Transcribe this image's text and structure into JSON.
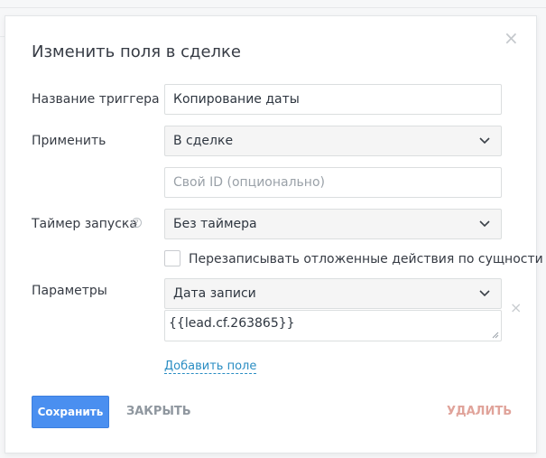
{
  "dialog": {
    "title": "Изменить поля в сделке",
    "close_icon": "close-icon"
  },
  "form": {
    "trigger_name": {
      "label": "Название триггера",
      "value": "Копирование даты"
    },
    "apply": {
      "label": "Применить",
      "value": "В сделке"
    },
    "custom_id": {
      "placeholder": "Свой ID (опционально)"
    },
    "timer": {
      "label": "Таймер запуска",
      "value": "Без таймера",
      "help_icon": "?"
    },
    "overwrite": {
      "label": "Перезаписывать отложенные действия по сущности",
      "checked": false
    },
    "params": {
      "label": "Параметры",
      "field_value": "Дата записи",
      "template_value": "{{lead.cf.263865}}"
    },
    "add_field_label": "Добавить поле"
  },
  "footer": {
    "save_label": "Сохранить",
    "close_label": "ЗАКРЫТЬ",
    "delete_label": "УДАЛИТЬ"
  },
  "colors": {
    "accent": "#4a8ff0",
    "link": "#2a8dc3",
    "delete": "#e0a39a"
  }
}
